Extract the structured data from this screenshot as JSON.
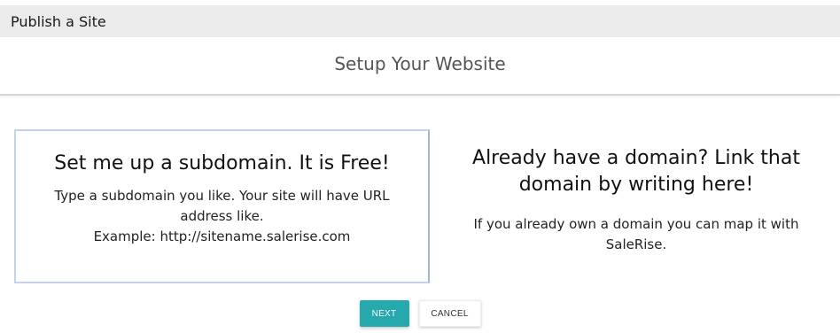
{
  "window": {
    "title": "Publish a Site"
  },
  "page": {
    "heading": "Setup Your Website"
  },
  "options": {
    "subdomain": {
      "title": "Set me up a subdomain. It is Free!",
      "description_line1": "Type a subdomain you like. Your site will have URL address like.",
      "description_line2": "Example: http://sitename.salerise.com"
    },
    "own_domain": {
      "title": "Already have a domain? Link that domain by writing here!",
      "description": "If you already own a domain you can map it with SaleRise."
    }
  },
  "actions": {
    "next_label": "NEXT",
    "cancel_label": "CANCEL"
  },
  "colors": {
    "accent": "#26a9ad",
    "titlebar_bg": "#ebebeb",
    "selected_border": "#c5d2ec"
  }
}
